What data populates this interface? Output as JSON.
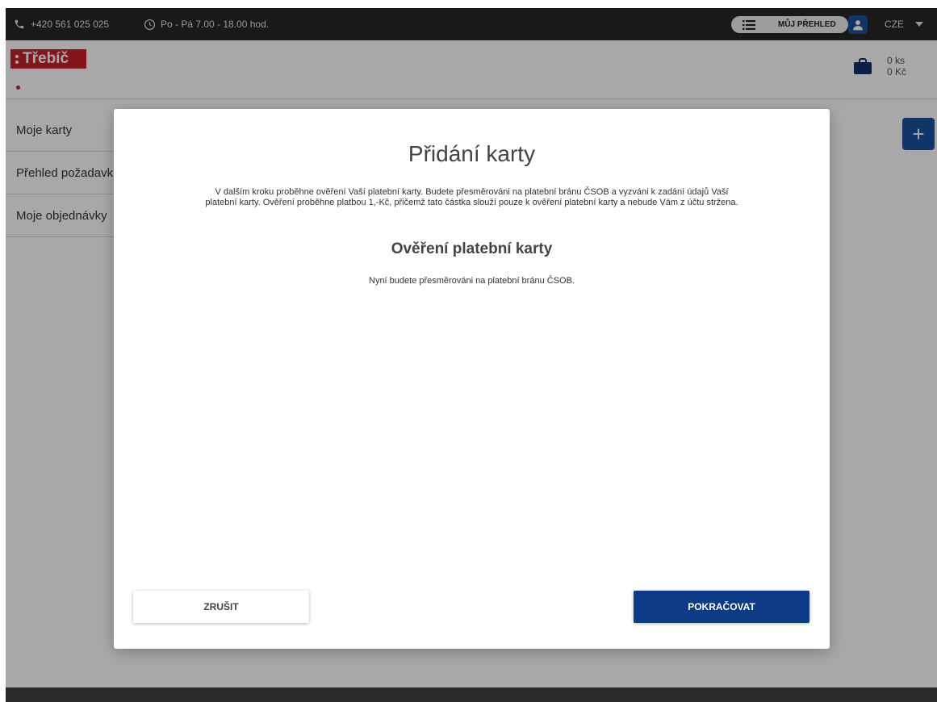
{
  "topbar": {
    "phone": "+420 561 025 025",
    "hours": "Po - Pá 7.00 - 18.00 hod.",
    "overview_label": "MŮJ PŘEHLED",
    "language": "CZE"
  },
  "header": {
    "logo_text": "Třebíč",
    "cart_count": "0 ks",
    "cart_total": "0 Kč"
  },
  "sidebar": {
    "items": [
      {
        "label": "Moje karty"
      },
      {
        "label": "Přehled požadavků"
      },
      {
        "label": "Moje objednávky"
      }
    ]
  },
  "add_button": {
    "label": "+"
  },
  "modal": {
    "title": "Přidání karty",
    "description": "V dalším kroku proběhne ověření Vaší platební karty. Budete přesměrováni na platební bránu ČSOB a vyzváni k zadání údajů Vaší platební karty. Ověření proběhne platbou 1,-Kč, přičemž tato částka slouží pouze k ověření platební karty a nebude Vám z účtu stržena.",
    "subtitle": "Ověření platební karty",
    "note": "Nyní budete přesměrováni na platební bránu ČSOB.",
    "cancel_label": "ZRUŠIT",
    "continue_label": "POKRAČOVAT"
  },
  "colors": {
    "brand_red": "#c8202a",
    "primary_blue": "#0d3b86",
    "topbar_bg": "#262626"
  },
  "icons": [
    "phone-icon",
    "clock-icon",
    "list-icon",
    "user-icon",
    "caret-down-icon",
    "shopping-bag-icon",
    "plus-icon"
  ]
}
